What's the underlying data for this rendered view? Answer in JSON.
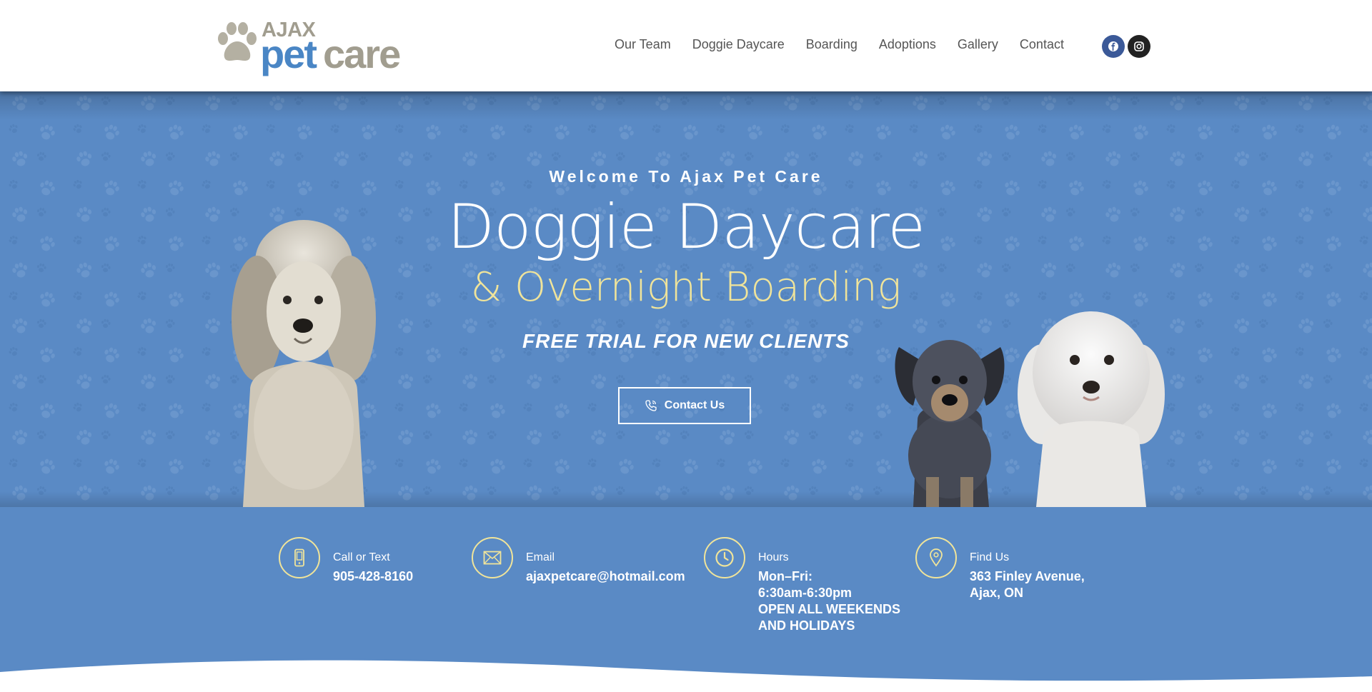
{
  "brand": {
    "ajax": "AJAX",
    "pet": "pet",
    "care": "care"
  },
  "nav": [
    {
      "label": "Our Team"
    },
    {
      "label": "Doggie Daycare"
    },
    {
      "label": "Boarding"
    },
    {
      "label": "Adoptions"
    },
    {
      "label": "Gallery"
    },
    {
      "label": "Contact"
    }
  ],
  "social": {
    "facebook": "facebook-icon",
    "instagram": "instagram-icon"
  },
  "hero": {
    "welcome": "Welcome To Ajax Pet Care",
    "title": "Doggie Daycare",
    "subtitle": "& Overnight Boarding",
    "trial": "FREE TRIAL FOR NEW CLIENTS",
    "cta_label": "Contact Us"
  },
  "info": {
    "call": {
      "label": "Call or Text",
      "value": "905-428-8160"
    },
    "email": {
      "label": "Email",
      "value": "ajaxpetcare@hotmail.com"
    },
    "hours": {
      "label": "Hours",
      "line1": "Mon–Fri:",
      "line2": "6:30am-6:30pm",
      "line3": "OPEN ALL WEEKENDS",
      "line4": "AND HOLIDAYS"
    },
    "find": {
      "label": "Find Us",
      "line1": "363 Finley Avenue,",
      "line2": "Ajax, ON"
    }
  },
  "colors": {
    "primary": "#5a8ac5",
    "accent": "#f0e49a",
    "brand_blue": "#4a86c5",
    "brand_grey": "#a19d8f"
  }
}
